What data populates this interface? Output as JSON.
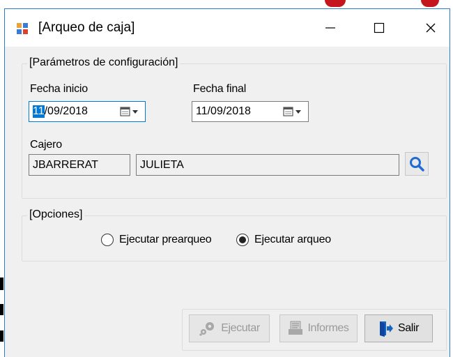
{
  "window": {
    "title": "[Arqueo de caja]",
    "minimize_glyph": "—",
    "close_glyph": "✕"
  },
  "config_group": {
    "title": "[Parámetros de configuración]",
    "fecha_inicio": {
      "label": "Fecha inicio",
      "value_selected": "11",
      "value_rest": "/09/2018"
    },
    "fecha_final": {
      "label": "Fecha final",
      "value": "11/09/2018"
    },
    "cajero": {
      "label": "Cajero",
      "code": "JBARRERAT",
      "name": "JULIETA"
    }
  },
  "options_group": {
    "title": "[Opciones]",
    "options": [
      {
        "label": "Ejecutar prearqueo",
        "selected": false
      },
      {
        "label": "Ejecutar arqueo",
        "selected": true
      }
    ]
  },
  "buttons": {
    "ejecutar": {
      "label": "Ejecutar",
      "enabled": false
    },
    "informes": {
      "label": "Informes",
      "enabled": false
    },
    "salir": {
      "label": "Salir",
      "enabled": true
    }
  },
  "colors": {
    "accent": "#0078d7",
    "window_border": "#2b79d6",
    "search_icon": "#1e6bd6",
    "exit_icon": "#1565c0"
  },
  "icons": {
    "app": "form-icon",
    "calendar": "calendar-dropdown-icon",
    "search": "search-icon",
    "ejecutar": "gears-icon",
    "informes": "report-icon",
    "salir": "exit-door-icon"
  }
}
